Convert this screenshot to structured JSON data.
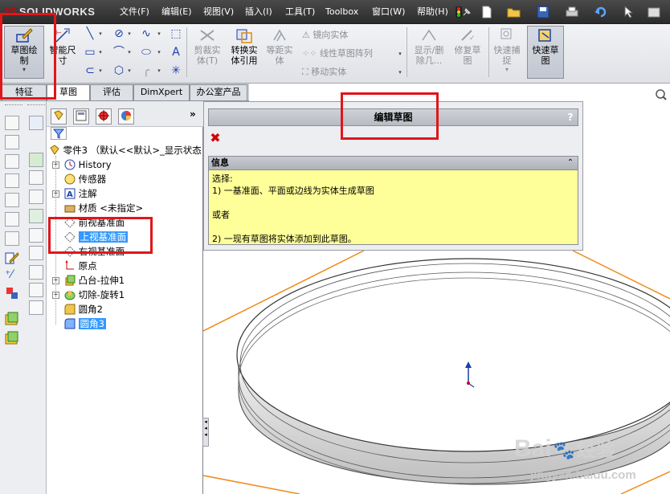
{
  "app": {
    "brand_prefix": "3S",
    "brand_name": "SOLIDWORKS"
  },
  "menu": [
    {
      "label": "文件(F)"
    },
    {
      "label": "编辑(E)"
    },
    {
      "label": "视图(V)"
    },
    {
      "label": "插入(I)"
    },
    {
      "label": "工具(T)"
    },
    {
      "label": "Toolbox"
    },
    {
      "label": "窗口(W)"
    },
    {
      "label": "帮助(H)"
    }
  ],
  "commands": {
    "sketch": "草图绘\n制",
    "smart_dim": "智能尺\n寸",
    "trim": "剪裁实\n体(T)",
    "convert": "转换实\n体引用",
    "offset": "等距实\n体",
    "mirror": "镜向实体",
    "linear_pattern": "线性草图阵列",
    "move": "移动实体",
    "display_delete": "显示/删\n除几...",
    "repair": "修复草\n图",
    "quick_snap": "快速捕\n捉",
    "rapid_sketch": "快速草\n图"
  },
  "tabs": [
    {
      "label": "特征"
    },
    {
      "label": "草图"
    },
    {
      "label": "评估"
    },
    {
      "label": "DimXpert"
    },
    {
      "label": "办公室产品"
    }
  ],
  "feature_tree": {
    "root": "零件3 （默认<<默认>_显示状态",
    "items": [
      {
        "label": "History"
      },
      {
        "label": "传感器"
      },
      {
        "label": "注解"
      },
      {
        "label": "材质 <未指定>"
      },
      {
        "label": "前视基准面"
      },
      {
        "label": "上视基准面"
      },
      {
        "label": "右视基准面"
      },
      {
        "label": "原点"
      },
      {
        "label": "凸台-拉伸1"
      },
      {
        "label": "切除-旋转1"
      },
      {
        "label": "圆角2"
      },
      {
        "label": "圆角3"
      }
    ],
    "expand_symbol": "+",
    "more_symbol": "»"
  },
  "property_manager": {
    "title": "编辑草图",
    "help": "?",
    "close_symbol": "✖",
    "info_title": "信息",
    "collapse_symbol": "⌃",
    "info_lines": [
      "选择:",
      "1) 一基准面、平面或边线为实体生成草图",
      "",
      "或者",
      "",
      "2) 一现有草图将实体添加到此草图。"
    ]
  },
  "watermark": {
    "brand": "Bai",
    "brand2": "经验",
    "url": "jingyan.baidu.com"
  },
  "colors": {
    "highlight_red": "#e0161b",
    "selection_blue": "#3399ff",
    "info_yellow": "#ffff99",
    "plane_orange": "#f08a1c"
  }
}
